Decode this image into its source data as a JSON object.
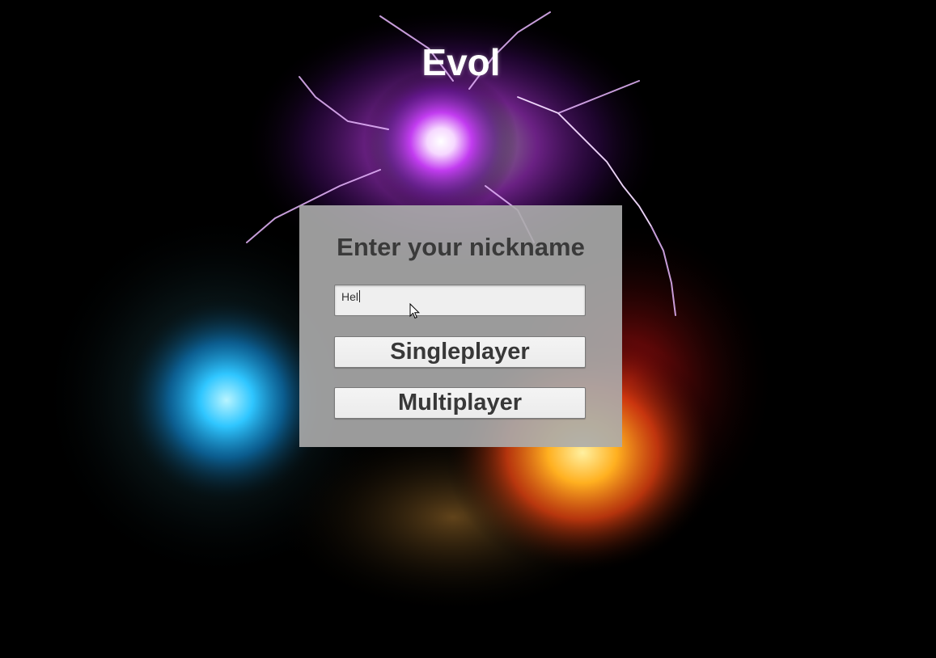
{
  "game": {
    "title": "Evol"
  },
  "menu": {
    "prompt": "Enter your nickname",
    "nickname_value": "Hel",
    "singleplayer_label": "Singleplayer",
    "multiplayer_label": "Multiplayer"
  },
  "colors": {
    "panel": "#acacac",
    "title_text": "#ffffff",
    "button_text": "#383838",
    "orb_purple": "#c040ff",
    "orb_blue": "#20b8ff",
    "orb_orange": "#ff6a10"
  },
  "icons": {
    "cursor": "mouse-pointer-icon"
  }
}
